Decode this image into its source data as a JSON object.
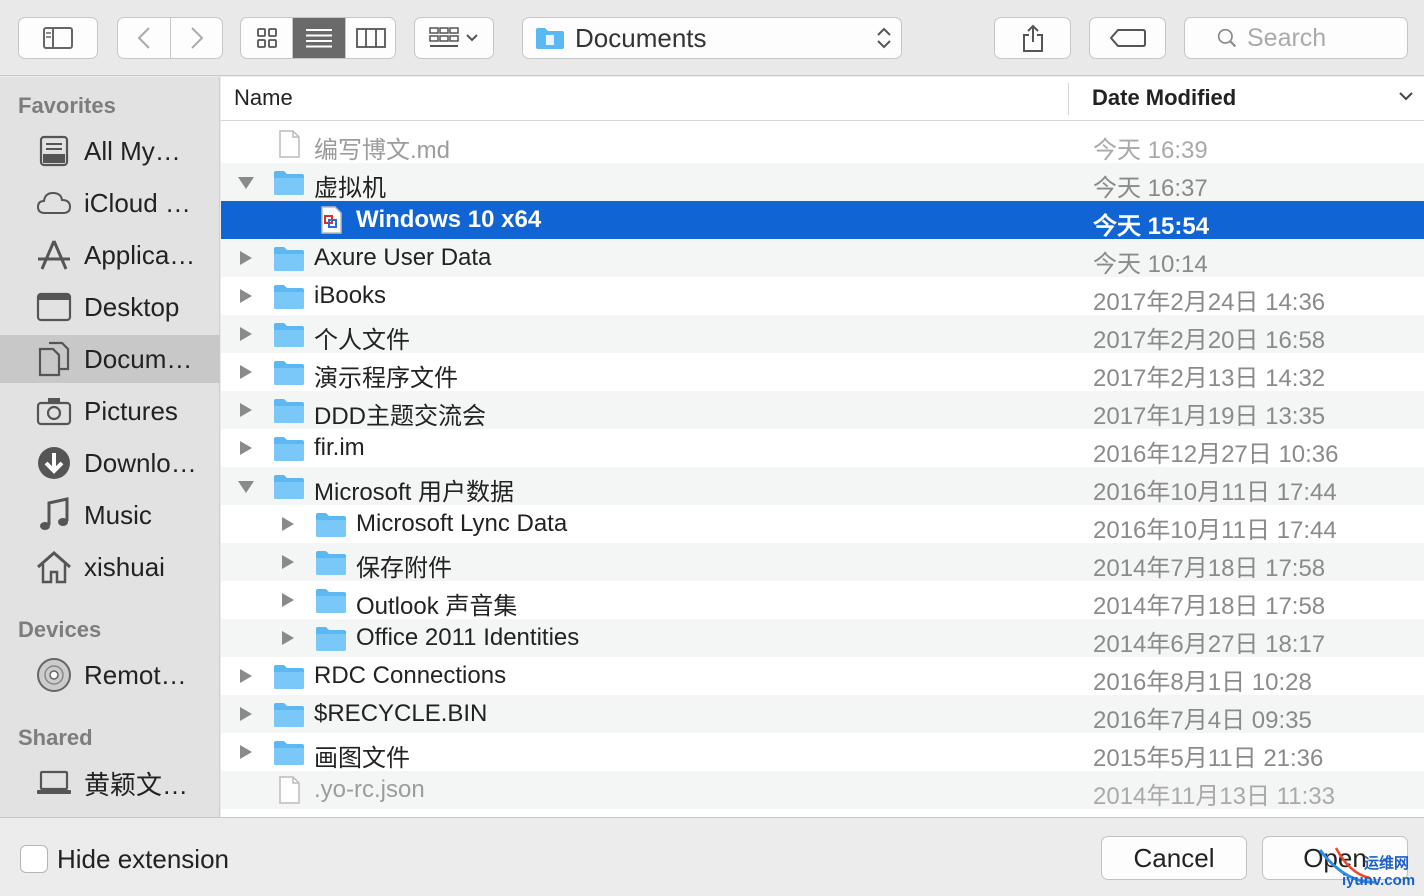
{
  "toolbar": {
    "path_label": "Documents",
    "search_placeholder": "Search"
  },
  "sidebar": {
    "sections": {
      "favorites": "Favorites",
      "devices": "Devices",
      "shared": "Shared"
    },
    "favorites": [
      {
        "label": "All My…",
        "icon": "all-my-files-icon"
      },
      {
        "label": "iCloud …",
        "icon": "cloud-icon"
      },
      {
        "label": "Applica…",
        "icon": "applications-icon"
      },
      {
        "label": "Desktop",
        "icon": "desktop-icon"
      },
      {
        "label": "Docum…",
        "icon": "documents-icon",
        "selected": true
      },
      {
        "label": "Pictures",
        "icon": "camera-icon"
      },
      {
        "label": "Downlo…",
        "icon": "download-icon"
      },
      {
        "label": "Music",
        "icon": "music-icon"
      },
      {
        "label": "xishuai",
        "icon": "home-icon"
      }
    ],
    "devices": [
      {
        "label": "Remot…",
        "icon": "disc-icon"
      }
    ],
    "shared": [
      {
        "label": "黄颖文…",
        "icon": "computer-icon"
      }
    ]
  },
  "list": {
    "columns": {
      "name": "Name",
      "date": "Date Modified"
    },
    "rows": [
      {
        "name": "编写博文.md",
        "date": "今天 16:39",
        "type": "file",
        "indent": 0,
        "disclosure": "none",
        "dim": true
      },
      {
        "name": "虚拟机",
        "date": "今天 16:37",
        "type": "folder",
        "indent": 0,
        "disclosure": "open"
      },
      {
        "name": "Windows 10 x64",
        "date": "今天 15:54",
        "type": "vm",
        "indent": 1,
        "disclosure": "none",
        "selected": true
      },
      {
        "name": "Axure User Data",
        "date": "今天 10:14",
        "type": "folder",
        "indent": 0,
        "disclosure": "closed"
      },
      {
        "name": "iBooks",
        "date": "2017年2月24日 14:36",
        "type": "folder",
        "indent": 0,
        "disclosure": "closed"
      },
      {
        "name": "个人文件",
        "date": "2017年2月20日 16:58",
        "type": "folder",
        "indent": 0,
        "disclosure": "closed"
      },
      {
        "name": "演示程序文件",
        "date": "2017年2月13日 14:32",
        "type": "folder",
        "indent": 0,
        "disclosure": "closed"
      },
      {
        "name": "DDD主题交流会",
        "date": "2017年1月19日 13:35",
        "type": "folder",
        "indent": 0,
        "disclosure": "closed"
      },
      {
        "name": "fir.im",
        "date": "2016年12月27日 10:36",
        "type": "folder",
        "indent": 0,
        "disclosure": "closed"
      },
      {
        "name": "Microsoft 用户数据",
        "date": "2016年10月11日 17:44",
        "type": "folder",
        "indent": 0,
        "disclosure": "open"
      },
      {
        "name": "Microsoft Lync Data",
        "date": "2016年10月11日 17:44",
        "type": "folder",
        "indent": 1,
        "disclosure": "closed"
      },
      {
        "name": "保存附件",
        "date": "2014年7月18日 17:58",
        "type": "folder",
        "indent": 1,
        "disclosure": "closed"
      },
      {
        "name": "Outlook 声音集",
        "date": "2014年7月18日 17:58",
        "type": "folder",
        "indent": 1,
        "disclosure": "closed"
      },
      {
        "name": "Office 2011 Identities",
        "date": "2014年6月27日 18:17",
        "type": "folder",
        "indent": 1,
        "disclosure": "closed"
      },
      {
        "name": "RDC Connections",
        "date": "2016年8月1日 10:28",
        "type": "folder",
        "indent": 0,
        "disclosure": "closed"
      },
      {
        "name": "$RECYCLE.BIN",
        "date": "2016年7月4日 09:35",
        "type": "folder",
        "indent": 0,
        "disclosure": "closed"
      },
      {
        "name": "画图文件",
        "date": "2015年5月11日 21:36",
        "type": "folder",
        "indent": 0,
        "disclosure": "closed"
      },
      {
        "name": ".yo-rc.json",
        "date": "2014年11月13日 11:33",
        "type": "file",
        "indent": 0,
        "disclosure": "none",
        "dim": true
      }
    ]
  },
  "bottom": {
    "hide_extension_label": "Hide extension",
    "hide_extension_checked": false,
    "cancel_label": "Cancel",
    "open_label": "Open"
  },
  "watermark": {
    "line1": "运维网",
    "line2": "iyunv.com"
  },
  "colors": {
    "selection": "#1164d4",
    "folder": "#5bb8f2"
  }
}
